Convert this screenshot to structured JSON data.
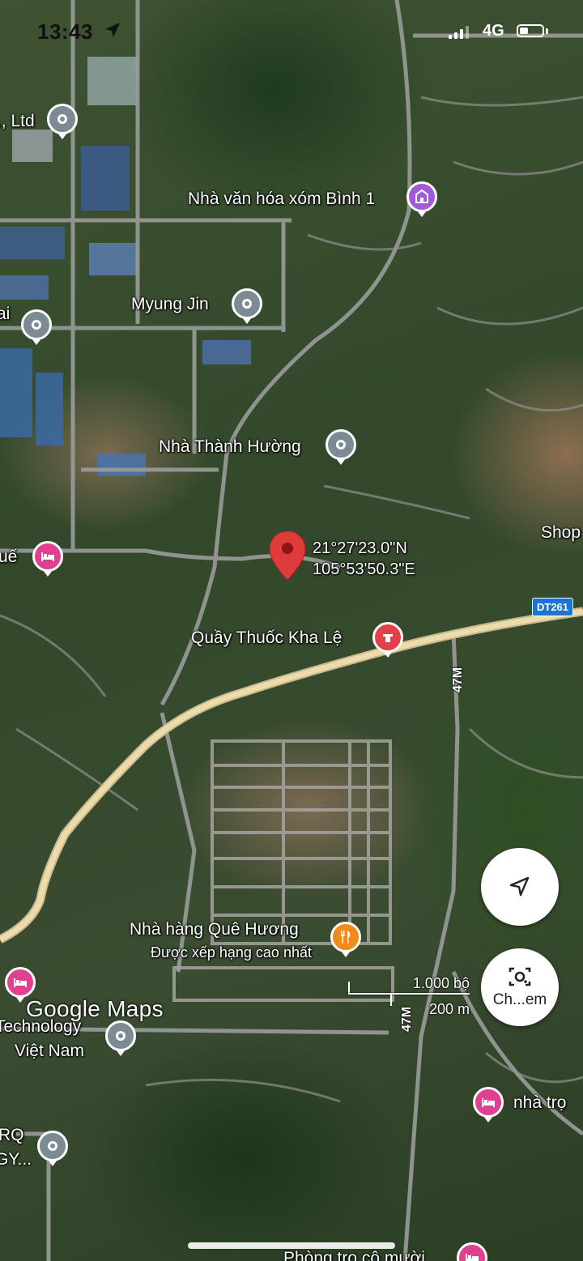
{
  "status_bar": {
    "time": "13:43",
    "network": "4G"
  },
  "marker": {
    "lat": "21°27'23.0\"N",
    "lng": "105°53'50.3\"E"
  },
  "places": {
    "ltd": "., Ltd",
    "nha_van_hoa": "Nhà văn hóa xóm Bình 1",
    "myung_jin": "Myung Jin",
    "ai": "ai",
    "nha_thanh_huong": "Nhà Thành Hường",
    "shop": "Shop",
    "hue": "uế",
    "quay_thuoc": "Quầy Thuốc Kha Lệ",
    "nha_hang": "Nhà hàng Quê Hương",
    "nha_hang_sub": "Được xếp hạng cao nhất",
    "technology": "Technology",
    "viet_nam": "Việt Nam",
    "rq": "RQ",
    "gy": "GY...",
    "nha_tro": "nhà trọ",
    "phong_tro": "Phòng trọ cô mười"
  },
  "roads": {
    "dt261": "DT261",
    "r47m_a": "47M",
    "r47m_b": "47M"
  },
  "scale": {
    "feet": "1.000 bộ",
    "meters": "200 m"
  },
  "buttons": {
    "lens_label": "Ch...em"
  },
  "branding": "Google Maps",
  "colors": {
    "marker": "#e03b3b",
    "poi_grey": "#7b8a93",
    "poi_pink": "#e0408f",
    "poi_purple": "#a25adb",
    "poi_orange": "#f08a1c",
    "road_main": "#e8d6a4",
    "road_shield": "#1b76d1"
  }
}
